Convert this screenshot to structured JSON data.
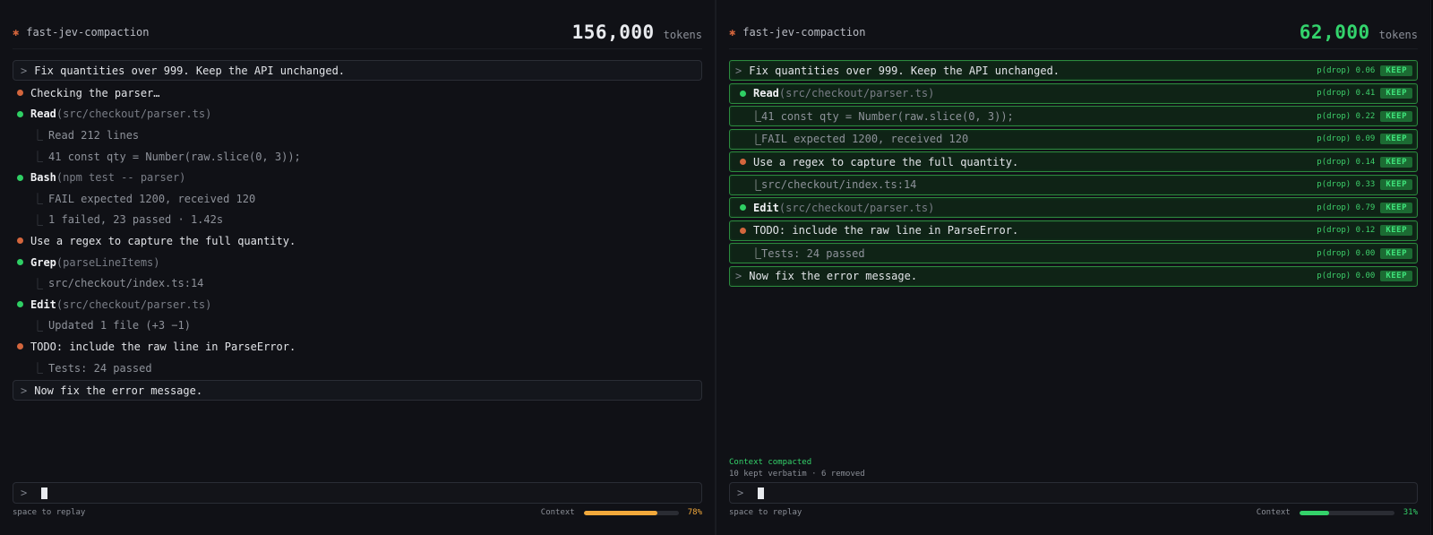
{
  "left": {
    "project": "fast-jev-compaction",
    "tokens": "156,000",
    "tokens_label": "tokens",
    "rows": [
      {
        "kind": "prompt",
        "text": "Fix quantities over 999. Keep the API unchanged."
      },
      {
        "kind": "dot",
        "color": "orange",
        "text": "Checking the parser…"
      },
      {
        "kind": "tool",
        "tool": "Read",
        "args": "(src/checkout/parser.ts)"
      },
      {
        "kind": "sub",
        "text": "Read 212 lines"
      },
      {
        "kind": "sub",
        "text": "41  const qty = Number(raw.slice(0, 3));"
      },
      {
        "kind": "tool",
        "tool": "Bash",
        "args": "(npm test -- parser)"
      },
      {
        "kind": "sub",
        "text": "FAIL  expected 1200, received 120"
      },
      {
        "kind": "sub",
        "text": "1 failed, 23 passed · 1.42s"
      },
      {
        "kind": "dot",
        "color": "orange",
        "text": "Use a regex to capture the full quantity."
      },
      {
        "kind": "tool",
        "tool": "Grep",
        "args": "(parseLineItems)"
      },
      {
        "kind": "sub",
        "text": "src/checkout/index.ts:14"
      },
      {
        "kind": "tool",
        "tool": "Edit",
        "args": "(src/checkout/parser.ts)"
      },
      {
        "kind": "sub",
        "text": "Updated 1 file (+3 −1)"
      },
      {
        "kind": "dot",
        "color": "orange",
        "text": "TODO: include the raw line in ParseError."
      },
      {
        "kind": "sub",
        "text": "Tests: 24 passed"
      },
      {
        "kind": "prompt",
        "text": "Now fix the error message."
      }
    ],
    "input_caret": ">",
    "hint": "space to replay",
    "context_label": "Context",
    "context_pct": "78%",
    "context_fraction": 0.78
  },
  "right": {
    "project": "fast-jev-compaction",
    "tokens": "62,000",
    "tokens_label": "tokens",
    "keep_label": "KEEP",
    "rows": [
      {
        "kind": "prompt",
        "text": "Fix quantities over 999. Keep the API unchanged.",
        "pdrop": "p(drop) 0.06"
      },
      {
        "kind": "tool",
        "tool": "Read",
        "args": "(src/checkout/parser.ts)",
        "pdrop": "p(drop) 0.41"
      },
      {
        "kind": "sub",
        "text": "41  const qty = Number(raw.slice(0, 3));",
        "pdrop": "p(drop) 0.22"
      },
      {
        "kind": "sub",
        "text": "FAIL  expected 1200, received 120",
        "pdrop": "p(drop) 0.09"
      },
      {
        "kind": "dot",
        "color": "orange",
        "text": "Use a regex to capture the full quantity.",
        "pdrop": "p(drop) 0.14"
      },
      {
        "kind": "sub",
        "text": "src/checkout/index.ts:14",
        "pdrop": "p(drop) 0.33"
      },
      {
        "kind": "tool",
        "tool": "Edit",
        "args": "(src/checkout/parser.ts)",
        "pdrop": "p(drop) 0.79"
      },
      {
        "kind": "dot",
        "color": "orange",
        "text": "TODO: include the raw line in ParseError.",
        "pdrop": "p(drop) 0.12"
      },
      {
        "kind": "sub",
        "text": "Tests: 24 passed",
        "pdrop": "p(drop) 0.00"
      },
      {
        "kind": "prompt",
        "text": "Now fix the error message.",
        "pdrop": "p(drop) 0.00"
      }
    ],
    "status_title": "Context compacted",
    "status_detail": "10 kept verbatim · 6 removed",
    "input_caret": ">",
    "hint": "space to replay",
    "context_label": "Context",
    "context_pct": "31%",
    "context_fraction": 0.31
  },
  "colors": {
    "orange": "#d4663d",
    "green": "#2fcf64",
    "keep_border": "#2c8a3e"
  }
}
